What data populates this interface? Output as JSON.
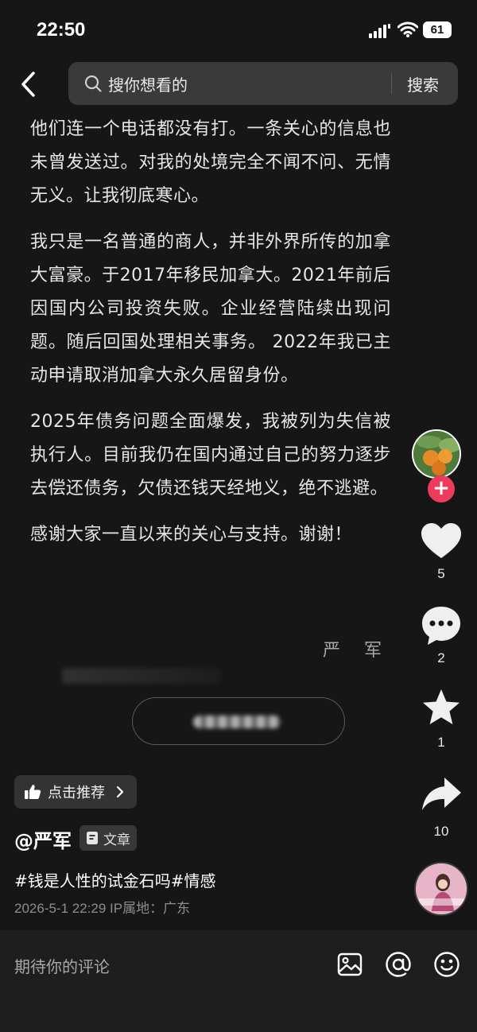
{
  "status_bar": {
    "time": "22:50",
    "battery": "61"
  },
  "header": {
    "search_placeholder": "搜你想看的",
    "search_button": "搜索"
  },
  "article": {
    "paragraphs": [
      "他们连一个电话都没有打。一条关心的信息也未曾发送过。对我的处境完全不闻不问、无情无义。让我彻底寒心。",
      "我只是一名普通的商人，并非外界所传的加拿大富豪。于2017年移民加拿大。2021年前后因国内公司投资失败。企业经营陆续出现问题。随后回国处理相关事务。 2022年我已主动申请取消加拿大永久居留身份。",
      "2025年债务问题全面爆发，我被列为失信被执行人。目前我仍在国内通过自己的努力逐步去偿还债务，欠债还钱天经地义，绝不逃避。",
      "感谢大家一直以来的关心与支持。谢谢！"
    ],
    "signature": "严军"
  },
  "actions": {
    "likes": "5",
    "comments": "2",
    "favorites": "1",
    "shares": "10"
  },
  "info": {
    "recommend_label": "点击推荐",
    "author": "@严军",
    "type_label": "文章",
    "hashtags": "#钱是人性的试金石吗#情感",
    "meta": "2026-5-1 22:29  IP属地：广东"
  },
  "comment_bar": {
    "placeholder": "期待你的评论"
  },
  "colors": {
    "background": "#161616",
    "follow_accent": "#ef3b5b",
    "text": "#e6e6e6"
  },
  "icons": [
    "back-arrow-icon",
    "search-icon",
    "heart-icon",
    "comment-icon",
    "star-icon",
    "share-icon",
    "image-icon",
    "at-icon",
    "emoji-icon",
    "thumb-up-icon",
    "document-icon",
    "chevron-right-icon"
  ]
}
